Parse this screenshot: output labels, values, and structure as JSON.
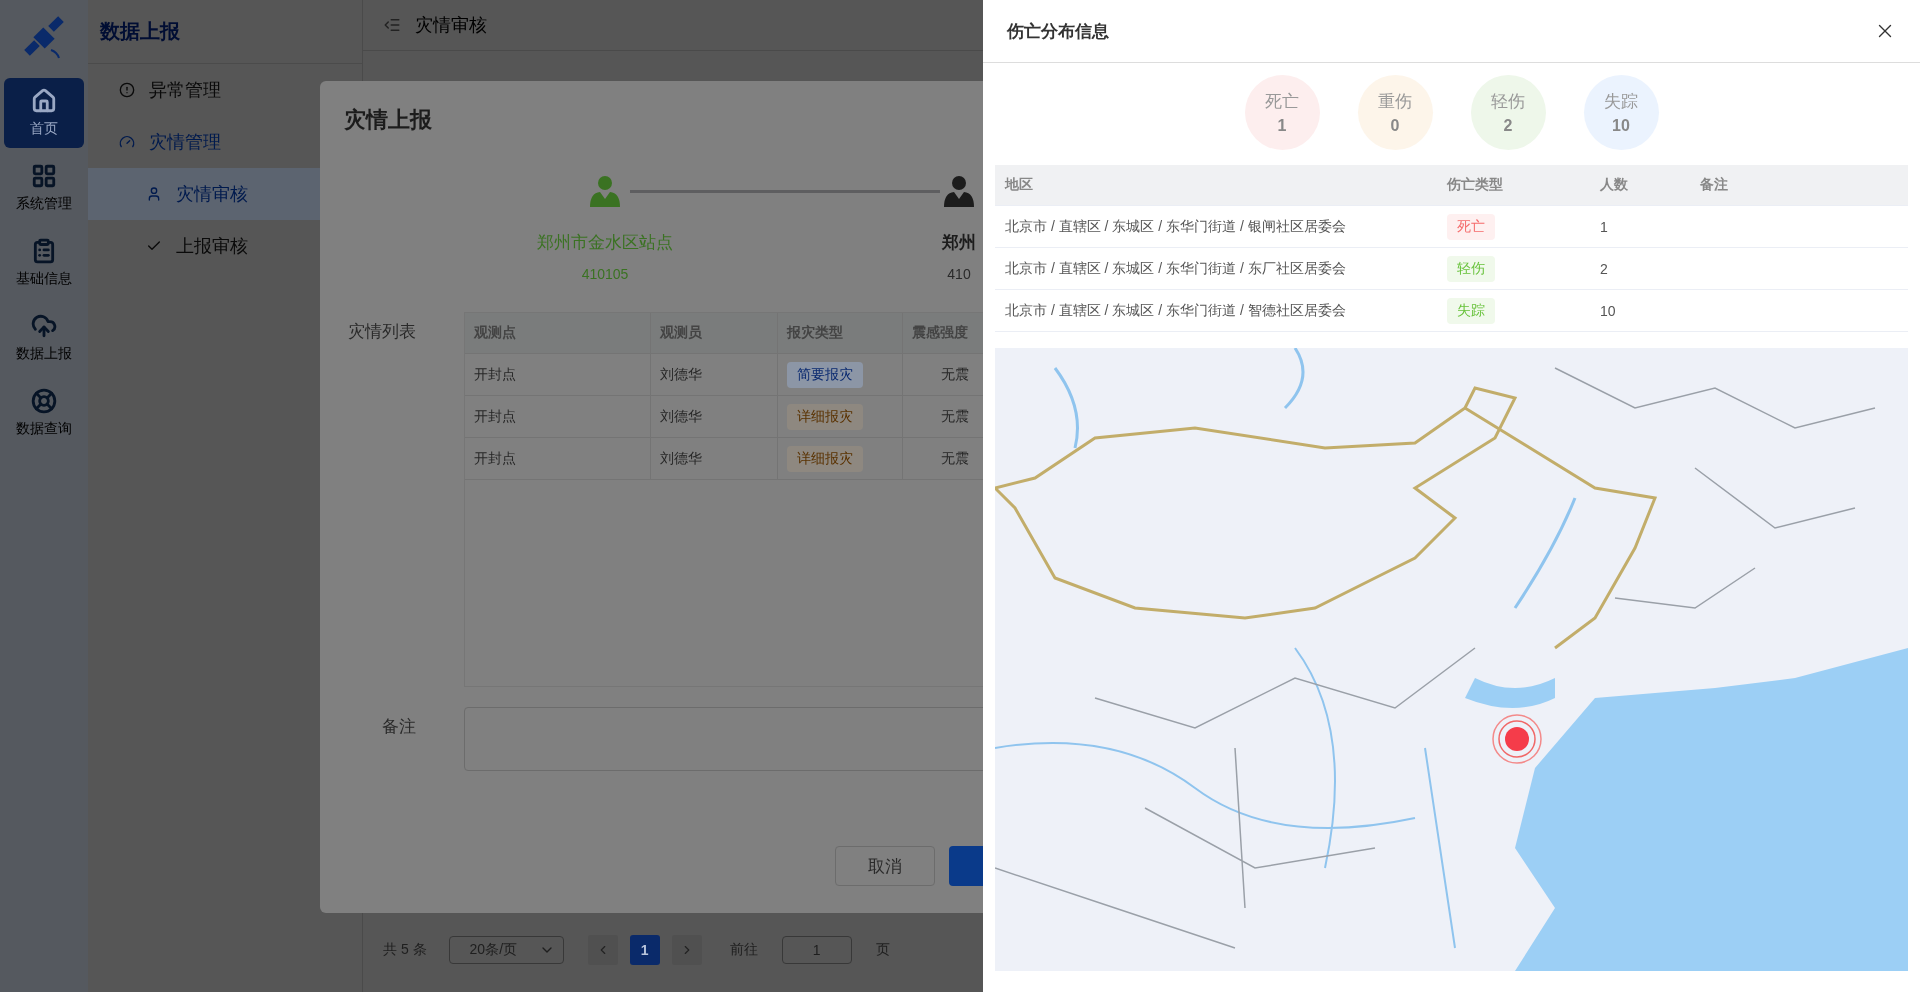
{
  "rail": {
    "items": [
      {
        "label": "首页",
        "selected": true
      },
      {
        "label": "系统管理",
        "selected": false
      },
      {
        "label": "基础信息",
        "selected": false
      },
      {
        "label": "数据上报",
        "selected": false
      },
      {
        "label": "数据查询",
        "selected": false
      }
    ]
  },
  "menu": {
    "title": "数据上报",
    "items": [
      {
        "label": "异常管理",
        "selected": false
      },
      {
        "label": "灾情管理",
        "selected": true,
        "children": [
          {
            "label": "灾情审核",
            "selected": true
          },
          {
            "label": "上报审核",
            "selected": false
          }
        ]
      }
    ]
  },
  "header": {
    "title": "灾情审核"
  },
  "pagination": {
    "total": "共 5 条",
    "page_size": "20条/页",
    "pages": [
      {
        "label": "1",
        "selected": true
      }
    ],
    "goto_label": "前往",
    "goto_value": "1",
    "page_suffix": "页"
  },
  "dialog": {
    "title": "灾情上报",
    "steps": [
      {
        "name": "郑州市金水区站点",
        "code": "410105",
        "done": true
      },
      {
        "name": "郑州",
        "code": "410",
        "done": false
      }
    ],
    "list_label": "灾情列表",
    "columns": [
      "观测点",
      "观测员",
      "报灾类型",
      "震感强度"
    ],
    "rows": [
      {
        "point": "开封点",
        "observer": "刘德华",
        "type": "简要报灾",
        "kind": "brief",
        "intensity": "无震"
      },
      {
        "point": "开封点",
        "observer": "刘德华",
        "type": "详细报灾",
        "kind": "detail",
        "intensity": "无震"
      },
      {
        "point": "开封点",
        "observer": "刘德华",
        "type": "详细报灾",
        "kind": "detail",
        "intensity": "无震"
      }
    ],
    "remark_label": "备注",
    "cancel": "取消"
  },
  "drawer": {
    "title": "伤亡分布信息",
    "stats": [
      {
        "label": "死亡",
        "value": "1",
        "color": "#fdeeee"
      },
      {
        "label": "重伤",
        "value": "0",
        "color": "#fdf5ea"
      },
      {
        "label": "轻伤",
        "value": "2",
        "color": "#eef7ea"
      },
      {
        "label": "失踪",
        "value": "10",
        "color": "#ebf3fe"
      }
    ],
    "columns": [
      "地区",
      "伤亡类型",
      "人数",
      "备注"
    ],
    "rows": [
      {
        "region": "北京市 / 直辖区 / 东城区 / 东华门街道 / 银闸社区居委会",
        "type": "死亡",
        "color": "#f56c6c",
        "count": "1"
      },
      {
        "region": "北京市 / 直辖区 / 东城区 / 东华门街道 / 东厂社区居委会",
        "type": "轻伤",
        "color": "#67c23a",
        "count": "2"
      },
      {
        "region": "北京市 / 直辖区 / 东城区 / 东华门街道 / 智德社区居委会",
        "type": "失踪",
        "color": "#67c23a",
        "count": "10"
      }
    ],
    "map": {
      "kind": "picture"
    }
  }
}
